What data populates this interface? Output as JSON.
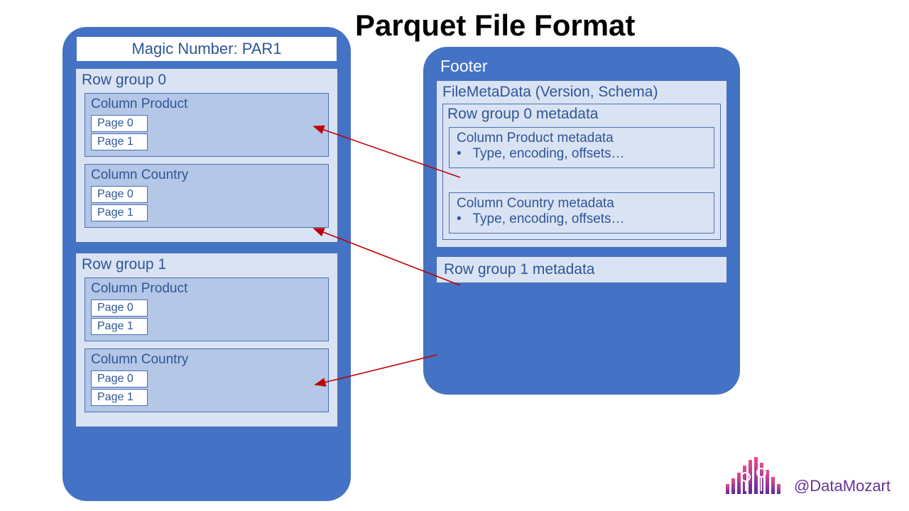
{
  "title": "Parquet File Format",
  "magic": "Magic Number: PAR1",
  "rowgroups": [
    {
      "label": "Row group 0",
      "columns": [
        {
          "label": "Column Product",
          "pages": [
            "Page 0",
            "Page 1"
          ]
        },
        {
          "label": "Column Country",
          "pages": [
            "Page 0",
            "Page 1"
          ]
        }
      ]
    },
    {
      "label": "Row group 1",
      "columns": [
        {
          "label": "Column Product",
          "pages": [
            "Page 0",
            "Page 1"
          ]
        },
        {
          "label": "Column Country",
          "pages": [
            "Page 0",
            "Page 1"
          ]
        }
      ]
    }
  ],
  "footer": {
    "label": "Footer",
    "filemeta": "FileMetaData (Version, Schema)",
    "rg0": {
      "label": "Row group 0 metadata",
      "col_product": {
        "title": "Column Product metadata",
        "detail": "Type, encoding, offsets…"
      },
      "col_country": {
        "title": "Column Country metadata",
        "detail": "Type, encoding, offsets…"
      }
    },
    "rg1_label": "Row group 1 metadata"
  },
  "attribution": "@DataMozart",
  "bullet": "•"
}
